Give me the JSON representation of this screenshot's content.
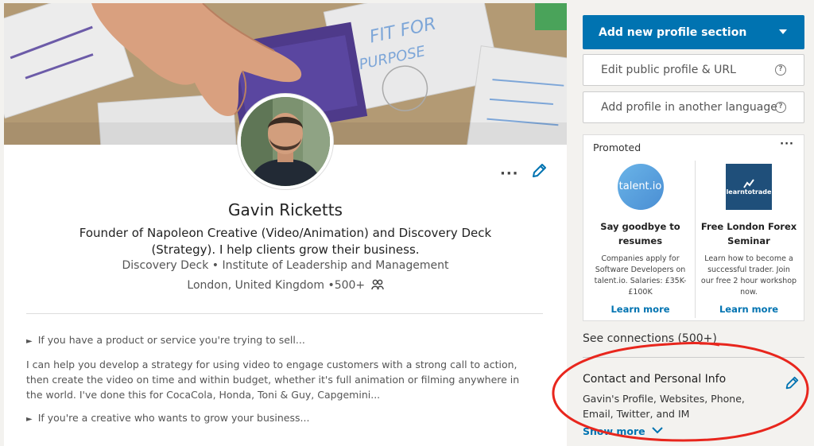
{
  "profile": {
    "name": "Gavin Ricketts",
    "headline": "Founder of Napoleon Creative (Video/Animation) and Discovery Deck (Strategy). I help clients grow their business.",
    "company": "Discovery Deck",
    "separator": "•",
    "school": "Institute of Leadership and Management",
    "location": "London, United Kingdom",
    "connections_short": "•500+",
    "more_label": "···"
  },
  "summary": {
    "para1": "If you have a product or service you're trying to sell...",
    "para2": "I can help you develop a strategy for using video to engage customers with a strong call to action, then create the video on time and within budget, whether it's full animation or filming anywhere in the world. I've done this for CocaCola, Honda, Toni & Guy, Capgemini...",
    "para3": "If you're a creative who wants to grow your business...",
    "bullet": "►"
  },
  "rail": {
    "add_section": "Add new profile section",
    "edit_public": "Edit public profile & URL",
    "add_language": "Add profile in another language",
    "help_glyph": "?"
  },
  "promoted": {
    "title": "Promoted",
    "menu": "···",
    "ads": [
      {
        "logo_text": "talent.io",
        "headline": "Say goodbye to resumes",
        "body": "Companies apply for Software Developers on talent.io. Salaries: £35K-£100K",
        "link": "Learn more"
      },
      {
        "logo_text": "learntotrade",
        "headline": "Free London Forex Seminar",
        "body": "Learn how to become a successful trader. Join our free 2 hour workshop now.",
        "link": "Learn more"
      }
    ]
  },
  "connections": {
    "label": "See connections (500+)"
  },
  "contact": {
    "title": "Contact and Personal Info",
    "body": "Gavin's Profile, Websites, Phone, Email, Twitter, and IM",
    "show_more": "Show more"
  },
  "colors": {
    "accent": "#0073b1",
    "annotation": "#e8261d"
  },
  "icons": [
    "pencil-icon",
    "connections-icon",
    "help-icon",
    "chevron-down-icon",
    "more-icon"
  ]
}
